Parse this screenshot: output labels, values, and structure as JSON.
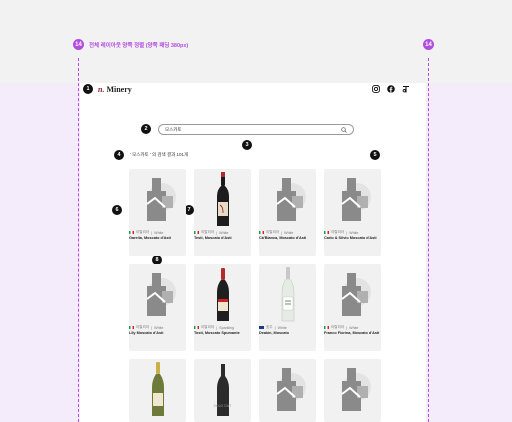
{
  "annotation": {
    "note_badge": "14",
    "note_text": "전체 레이아웃 양쪽 정렬 (양쪽 패딩 380px)"
  },
  "markers": [
    "1",
    "2",
    "3",
    "4",
    "5",
    "6",
    "7",
    "8"
  ],
  "header": {
    "logo_mark": "n.",
    "logo_text": "Minery"
  },
  "search": {
    "value": "모스카토"
  },
  "results": {
    "text": "' 모스카토 ' 의 검색 결과 101개"
  },
  "products": [
    {
      "country": "이탈리아",
      "type": "White",
      "name": "Garelia, Moscato d'Asti",
      "flag": "it"
    },
    {
      "country": "이탈리아",
      "type": "White",
      "name": "Testi, Moscato d'Asti",
      "flag": "it"
    },
    {
      "country": "이탈리아",
      "type": "White",
      "name": "Cà'Bianca, Moscato d'Asti",
      "flag": "it"
    },
    {
      "country": "이탈리아",
      "type": "White",
      "name": "Carlo & Silvio Moscato d'Asti",
      "flag": "it"
    },
    {
      "country": "이탈리아",
      "type": "White",
      "name": "Lily Moscato d'Asti",
      "flag": "it"
    },
    {
      "country": "이탈리아",
      "type": "Sparkling",
      "name": "Tosti, Moscato Spumante",
      "flag": "it"
    },
    {
      "country": "호주",
      "type": "White",
      "name": "Deakin, Moscato",
      "flag": "au"
    },
    {
      "country": "이탈리아",
      "type": "White",
      "name": "Franco Fiorina, Moscato d'Asti",
      "flag": "it"
    }
  ],
  "row3": {
    "soldout_label": "SOLD OUT"
  },
  "colors": {
    "accent": "#b14ee0",
    "band": "#f4ecfb",
    "brand": "#8b1f2c"
  },
  "icons": [
    "instagram-icon",
    "facebook-icon",
    "tiktok-icon",
    "search-icon"
  ]
}
